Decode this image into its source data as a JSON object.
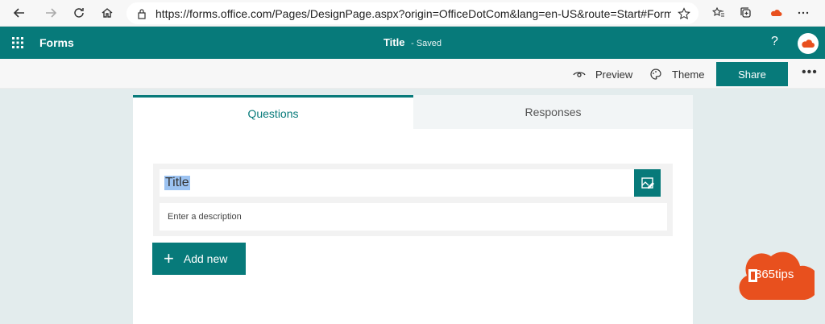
{
  "browser": {
    "url": "https://forms.office.com/Pages/DesignPage.aspx?origin=OfficeDotCom&lang=en-US&route=Start#FormId=..."
  },
  "header": {
    "app_name": "Forms",
    "doc_title": "Title",
    "save_status": "Saved",
    "help_label": "?"
  },
  "command_bar": {
    "preview_label": "Preview",
    "theme_label": "Theme",
    "share_label": "Share",
    "more_label": "•••"
  },
  "tabs": [
    {
      "label": "Questions",
      "active": true
    },
    {
      "label": "Responses",
      "active": false
    }
  ],
  "form": {
    "title_value": "Title",
    "description_placeholder": "Enter a description",
    "add_new_label": "Add new"
  },
  "watermark": {
    "text": "365tips"
  },
  "colors": {
    "accent": "#077a7a",
    "watermark": "#e8501e"
  }
}
